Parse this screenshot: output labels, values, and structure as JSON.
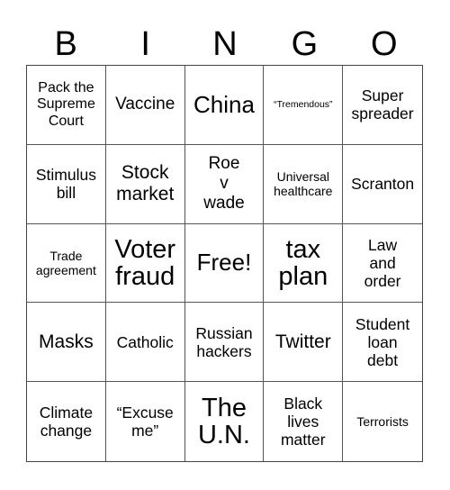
{
  "header": {
    "letters": [
      "B",
      "I",
      "N",
      "G",
      "O"
    ]
  },
  "cells": [
    "Pack the\nSupreme\nCourt",
    "Vaccine",
    "China",
    "“Tremendous”",
    "Super\nspreader",
    "Stimulus\nbill",
    "Stock\nmarket",
    "Roe\nv\nwade",
    "Universal\nhealthcare",
    "Scranton",
    "Trade\nagreement",
    "Voter\nfraud",
    "Free!",
    "tax\nplan",
    "Law\nand\norder",
    "Masks",
    "Catholic",
    "Russian\nhackers",
    "Twitter",
    "Student\nloan\ndebt",
    "Climate\nchange",
    "“Excuse\nme”",
    "The\nU.N.",
    "Black\nlives\nmatter",
    "Terrorists"
  ]
}
